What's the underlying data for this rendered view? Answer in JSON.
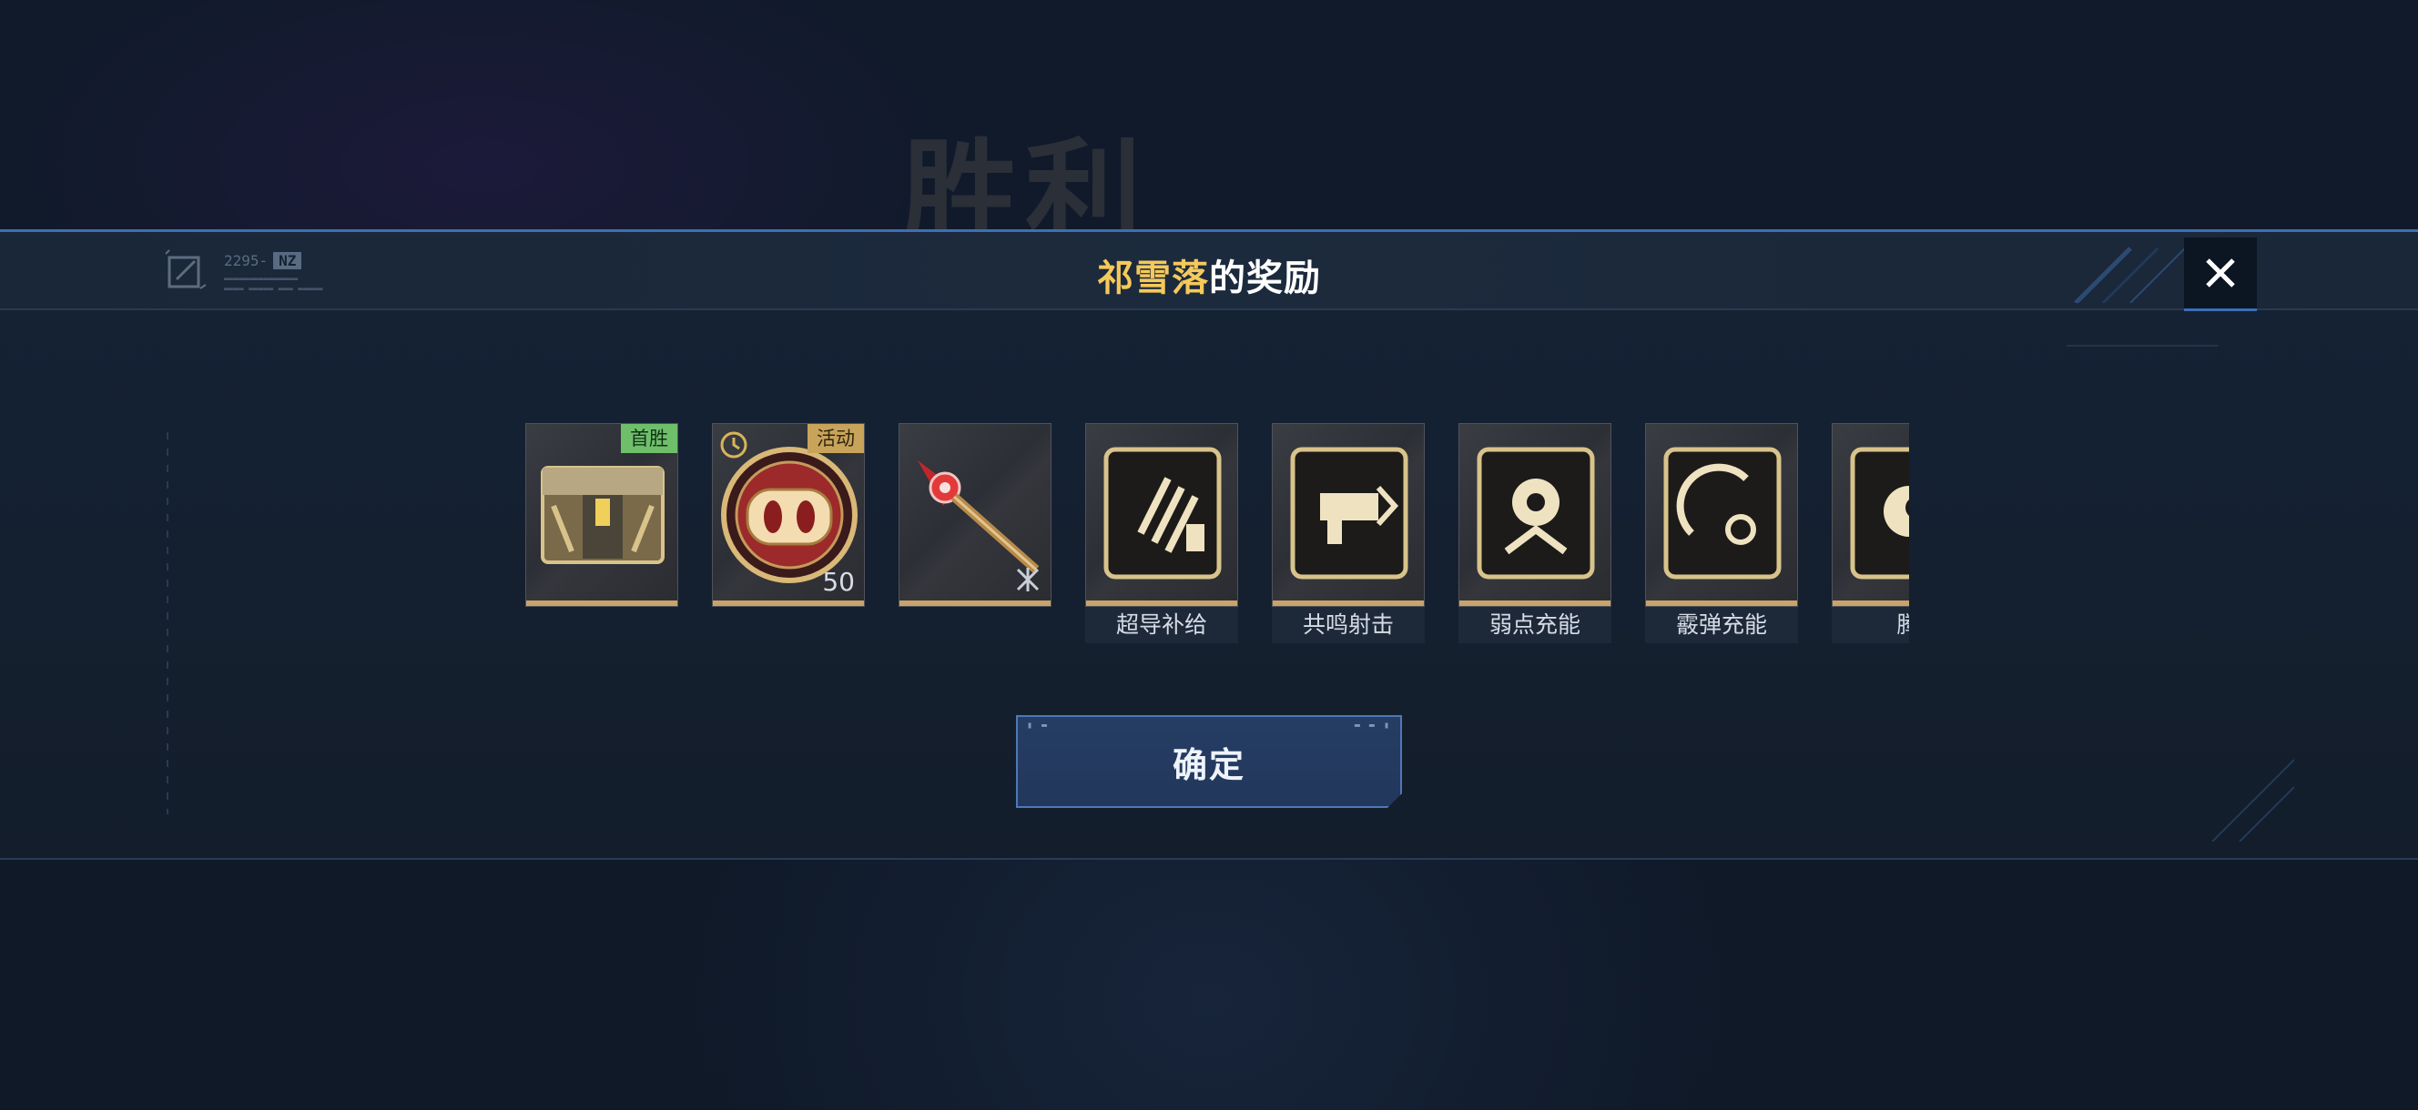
{
  "background": {
    "title": "胜利"
  },
  "header": {
    "title_name": "祁雪落",
    "title_suffix": "的奖励",
    "corner_code": "2295-",
    "corner_tag": "NZ"
  },
  "rewards": [
    {
      "label": "",
      "badge": "首胜",
      "badge_color": "#6fbf6a",
      "icon": "treasure-chest-icon",
      "qty": ""
    },
    {
      "label": "",
      "badge": "活动",
      "badge_color": "#c8a45a",
      "icon": "pig-coin-icon",
      "qty": "50",
      "timed": true
    },
    {
      "label": "",
      "badge": "",
      "icon": "red-staff-icon",
      "qty": ""
    },
    {
      "label": "超导补给",
      "badge": "",
      "icon": "supply-module-icon",
      "qty": ""
    },
    {
      "label": "共鸣射击",
      "badge": "",
      "icon": "resonance-shot-icon",
      "qty": ""
    },
    {
      "label": "弱点充能",
      "badge": "",
      "icon": "weakpoint-charge-icon",
      "qty": ""
    },
    {
      "label": "霰弹充能",
      "badge": "",
      "icon": "shotgun-charge-icon",
      "qty": ""
    },
    {
      "label": "腾",
      "badge": "",
      "icon": "partial-module-icon",
      "qty": ""
    }
  ],
  "confirm_button": {
    "label": "确定"
  },
  "colors": {
    "accent": "#3d6fb5",
    "gold": "#c8a46a",
    "name_highlight": "#f5c95a"
  }
}
